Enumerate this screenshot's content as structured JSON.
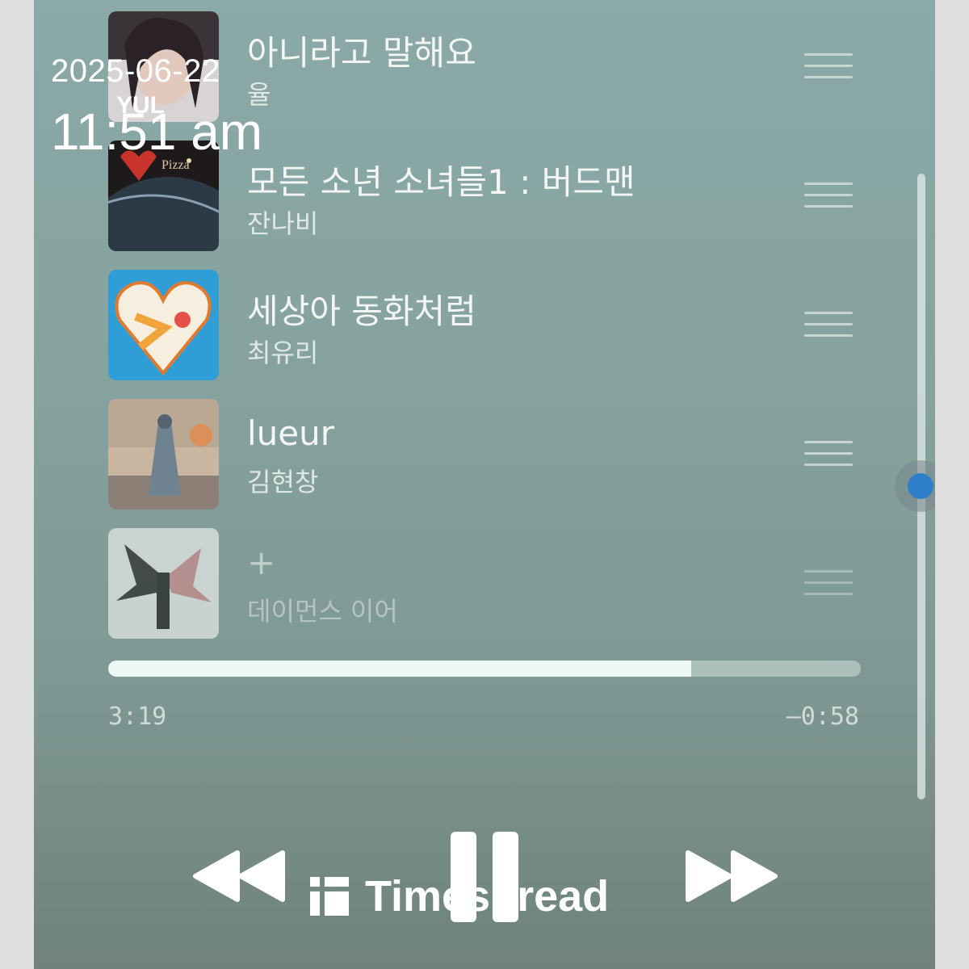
{
  "overlay": {
    "date": "2025-06-22",
    "time": "11:51 am",
    "watermark": "Timespread"
  },
  "queue": [
    {
      "title": "아니라고 말해요",
      "artist": "율",
      "art": "portrait-art"
    },
    {
      "title": "모든 소년 소녀들1 : 버드맨",
      "artist": "잔나비",
      "art": "planet-art"
    },
    {
      "title": "세상아 동화처럼",
      "artist": "최유리",
      "art": "heart-art"
    },
    {
      "title": "lueur",
      "artist": "김현창",
      "art": "painting-art"
    },
    {
      "title": "+",
      "artist": "데이먼스 이어",
      "art": "wings-art"
    }
  ],
  "playback": {
    "elapsed": "3:19",
    "remaining": "–0:58",
    "progress_fraction": 0.775
  },
  "controls": {
    "previous_icon": "rewind-icon",
    "pause_icon": "pause-icon",
    "next_icon": "fast-forward-icon"
  },
  "colors": {
    "background_top": "#8aa9a7",
    "background_bottom": "#6f827c",
    "progress_fill": "#eef8f6",
    "scroll_knob": "#2f7fc8"
  }
}
